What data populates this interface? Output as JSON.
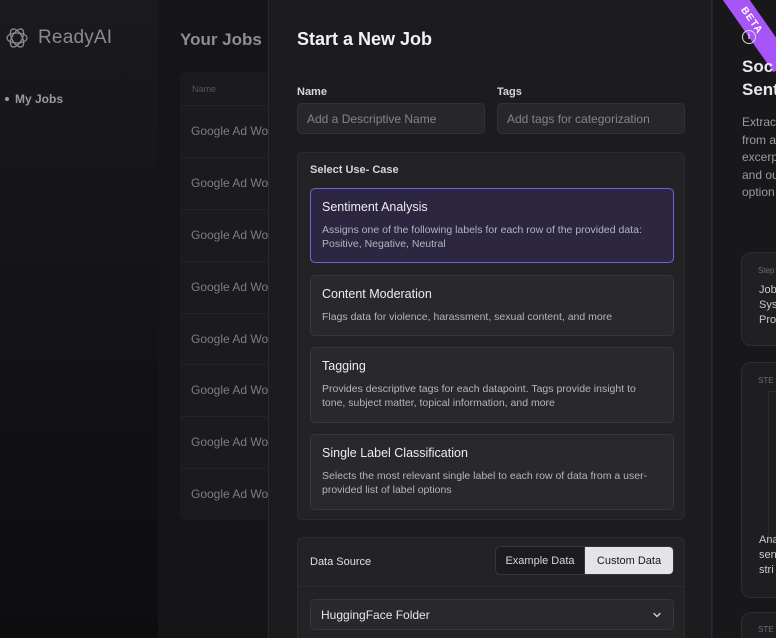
{
  "brand": {
    "name": "ReadyAI"
  },
  "sidebar": {
    "items": [
      {
        "label": "My Jobs"
      }
    ]
  },
  "jobs": {
    "title": "Your Jobs",
    "column_name": "Name",
    "rows": [
      "Google Ad Wo",
      "Google Ad Wo",
      "Google Ad Wo",
      "Google Ad Wo",
      "Google Ad Wo",
      "Google Ad Wo",
      "Google Ad Wo",
      "Google Ad Wo"
    ]
  },
  "modal": {
    "title": "Start a New Job",
    "name_label": "Name",
    "name_placeholder": "Add a Descriptive Name",
    "tags_label": "Tags",
    "tags_placeholder": "Add tags for categorization",
    "usecase_label": "Select Use- Case",
    "usecases": [
      {
        "title": "Sentiment Analysis",
        "description": "Assigns one of the following labels for each row of the provided data: Positive, Negative, Neutral",
        "selected": true
      },
      {
        "title": "Content Moderation",
        "description": "Flags data for violence, harassment, sexual content, and more",
        "selected": false
      },
      {
        "title": "Tagging",
        "description": "Provides descriptive tags for each datapoint. Tags provide insight to tone, subject matter, topical information, and more",
        "selected": false
      },
      {
        "title": "Single Label Classification",
        "description": "Selects the most relevant single label to each row of data from a user-provided list of label options",
        "selected": false
      }
    ],
    "data_source_label": "Data Source",
    "data_source_options": [
      "Example Data",
      "Custom Data"
    ],
    "data_source_selected": "Custom Data",
    "data_source_select_value": "HuggingFace Folder"
  },
  "right_panel": {
    "badge": "BETA",
    "title_lines": [
      "Soc",
      "Sent"
    ],
    "description_lines": [
      "Extrac",
      "from a",
      "excerp",
      "and ou",
      "option"
    ],
    "step1_label": "Step",
    "step1_lines": [
      "Job",
      "Sys",
      "Pro"
    ],
    "step2_label": "STE",
    "step2_lines": [
      "Ana",
      "sen",
      "stri"
    ],
    "step3_label": "STE"
  },
  "colors": {
    "accent": "#7c5ce0",
    "beta": "#a855f7",
    "background": "#1c1c1f"
  }
}
